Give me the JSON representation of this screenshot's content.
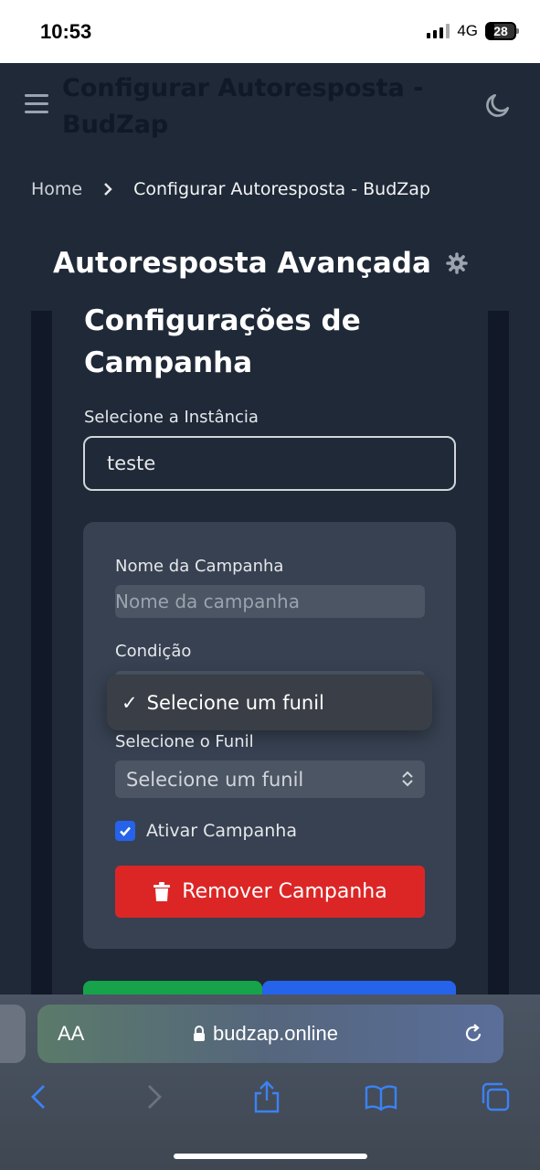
{
  "status_bar": {
    "time": "10:53",
    "network": "4G",
    "battery": "28"
  },
  "header": {
    "title": "Configurar Autoresposta - BudZap"
  },
  "breadcrumb": {
    "home": "Home",
    "separator": ">",
    "current": "Configurar Autoresposta - BudZap"
  },
  "page": {
    "heading": "Autoresposta Avançada",
    "card_title": "Configurações de Campanha",
    "instance_label": "Selecione a Instância",
    "instance_value": "teste"
  },
  "campaign": {
    "name_label": "Nome da Campanha",
    "name_placeholder": "Nome da campanha",
    "condition_label": "Condição",
    "dropdown_check": "✓",
    "dropdown_option": "Selecione um funil",
    "funnel_label": "Selecione o Funil",
    "funnel_value": "Selecione um funil",
    "activate_label": "Ativar Campanha",
    "activate_checked": true,
    "remove_label": "Remover Campanha"
  },
  "safari": {
    "aa_label": "AA",
    "url": "budzap.online"
  },
  "colors": {
    "accent_blue": "#2563eb",
    "danger_red": "#dc2626",
    "success_green": "#16a34a",
    "background": "#1f2937"
  }
}
